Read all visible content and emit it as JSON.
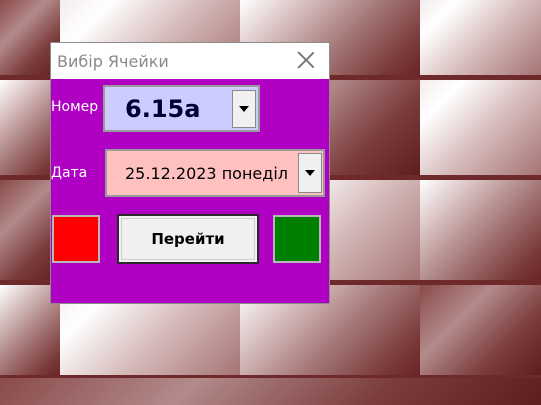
{
  "dialog": {
    "title": "Вибір Ячейки",
    "number_label": "Номер",
    "number_value": "6.15а",
    "date_label": "Дата",
    "date_value": "25.12.2023 понеділ",
    "go_button_label": "Перейти"
  },
  "colors": {
    "dialog_bg": "#b000c4",
    "number_field_bg": "#ccccff",
    "date_field_bg": "#ffc0c0",
    "left_square": "#ff0000",
    "right_square": "#008000"
  },
  "icons": {
    "close": "close-icon",
    "dropdown": "chevron-down-icon"
  }
}
